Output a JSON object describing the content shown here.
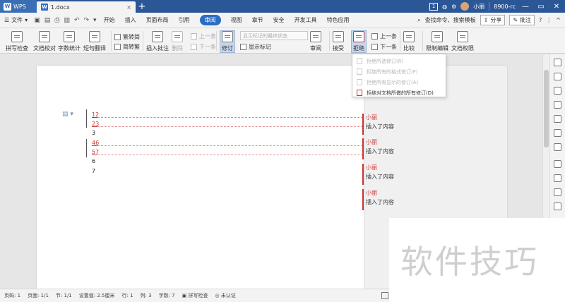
{
  "titlebar": {
    "app_name": "WPS",
    "doc_tab": "1.docx",
    "doc_tab_close": "×",
    "new_tab": "+",
    "badge": "1",
    "user": "小丽",
    "version": "8900-rc",
    "minimize": "—",
    "restore": "▭",
    "close": "✕"
  },
  "menubar": {
    "file": "文件",
    "tabs": [
      "开始",
      "插入",
      "页面布局",
      "引用",
      "审阅",
      "视图",
      "章节",
      "安全",
      "开发工具",
      "特色应用"
    ],
    "active_tab": "审阅",
    "search": "查找命令、搜索模板",
    "share": "分享",
    "annotate": "批注",
    "help": "?",
    "more": "⋮",
    "collapse": "^"
  },
  "ribbon": {
    "spell_check": "拼写检查",
    "doc_proof": "文档校对",
    "word_count": "字数统计",
    "translate": "短句翻译",
    "trad_to_simp": "繁转简",
    "simp_to_trad": "简转繁",
    "insert_comment": "插入批注",
    "delete": "删除",
    "prev_comment": "上一条",
    "next_comment": "下一条",
    "track_changes": "修订",
    "display_select": "显示标记的最终状态",
    "show_markup": "显示标记",
    "review": "审阅",
    "accept": "接受",
    "reject": "拒绝",
    "prev_change": "上一条",
    "next_change": "下一条",
    "compare": "比较",
    "restrict_edit": "限制编辑",
    "doc_permission": "文档权限"
  },
  "dropdown": {
    "items": [
      {
        "label": "拒绝所选修订(R)",
        "enabled": false
      },
      {
        "label": "拒绝所有的格式修订(F)",
        "enabled": false
      },
      {
        "label": "拒绝所有显示的修订(A)",
        "enabled": false
      },
      {
        "label": "拒绝对文档所做的所有修订(D)",
        "enabled": true
      }
    ]
  },
  "document": {
    "lines": [
      "12",
      "23",
      "3",
      "46",
      "57",
      "6",
      "7"
    ],
    "comments": [
      {
        "author": "小丽",
        "text": "插入了内容"
      },
      {
        "author": "小丽",
        "text": "插入了内容"
      },
      {
        "author": "小丽",
        "text": "插入了内容"
      },
      {
        "author": "小丽",
        "text": "插入了内容"
      }
    ]
  },
  "statusbar": {
    "page_no": "页码: 1",
    "pages": "页面: 1/1",
    "section": "节: 1/1",
    "setting": "设置值: 2.5厘米",
    "row": "行: 1",
    "col": "列: 3",
    "word_count": "字数: 7",
    "spell_check": "拼写检查",
    "not_certified": "未认证"
  },
  "watermark": "软件技巧",
  "colors": {
    "accent": "#2b6cc4",
    "revision": "#cc3333",
    "titlebar": "#2b5797"
  }
}
